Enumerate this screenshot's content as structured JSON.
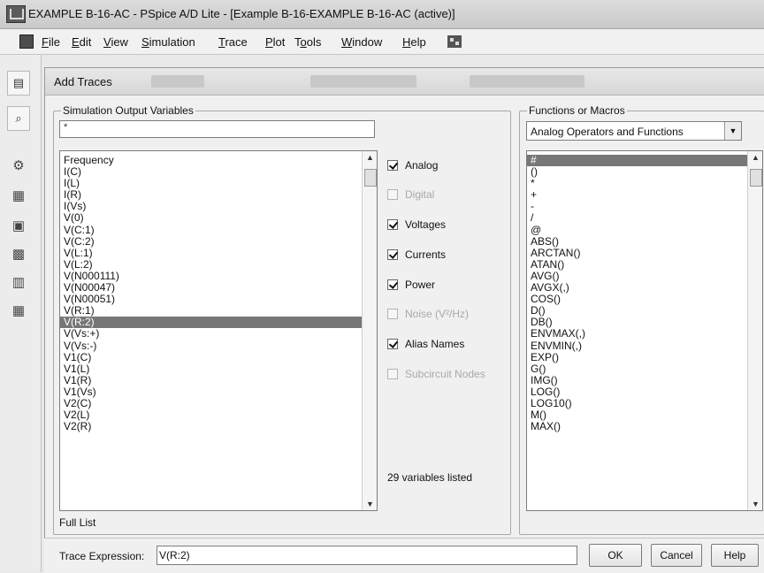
{
  "window": {
    "title": "EXAMPLE B-16-AC - PSpice A/D Lite  - [Example B-16-EXAMPLE B-16-AC (active)]"
  },
  "menu": [
    {
      "pre": "",
      "u": "F",
      "post": "ile"
    },
    {
      "pre": "",
      "u": "E",
      "post": "dit"
    },
    {
      "pre": "",
      "u": "V",
      "post": "iew"
    },
    {
      "pre": "",
      "u": "S",
      "post": "imulation"
    },
    {
      "pre": "",
      "u": "T",
      "post": "race"
    },
    {
      "pre": "",
      "u": "P",
      "post": "lot"
    },
    {
      "pre": "T",
      "u": "o",
      "post": "ols"
    },
    {
      "pre": "",
      "u": "W",
      "post": "indow"
    },
    {
      "pre": "",
      "u": "H",
      "post": "elp"
    }
  ],
  "dialog": {
    "title": "Add Traces",
    "output_group_label": "Simulation Output Variables",
    "filter_value": "*",
    "variables": [
      "Frequency",
      "I(C)",
      "I(L)",
      "I(R)",
      "I(Vs)",
      "V(0)",
      "V(C:1)",
      "V(C:2)",
      "V(L:1)",
      "V(L:2)",
      "V(N000111)",
      "V(N00047)",
      "V(N00051)",
      "V(R:1)",
      "V(R:2)",
      "V(Vs:+)",
      "V(Vs:-)",
      "V1(C)",
      "V1(L)",
      "V1(R)",
      "V1(Vs)",
      "V2(C)",
      "V2(L)",
      "V2(R)"
    ],
    "selected_variable": "V(R:2)",
    "options": [
      {
        "label": "Analog",
        "checked": true,
        "enabled": true
      },
      {
        "label": "Digital",
        "checked": false,
        "enabled": false
      },
      {
        "label": "Voltages",
        "checked": true,
        "enabled": true
      },
      {
        "label": "Currents",
        "checked": true,
        "enabled": true
      },
      {
        "label": "Power",
        "checked": true,
        "enabled": true
      },
      {
        "label": "Noise (V²/Hz)",
        "checked": false,
        "enabled": false
      },
      {
        "label": "Alias Names",
        "checked": true,
        "enabled": true
      },
      {
        "label": "Subcircuit Nodes",
        "checked": false,
        "enabled": false
      }
    ],
    "variable_count": "29 variables listed",
    "list_mode": "Full List",
    "functions_group_label": "Functions or Macros",
    "functions_selected": "Analog Operators and Functions",
    "functions": [
      "#",
      "()",
      "*",
      "+",
      "-",
      "/",
      "@",
      "ABS()",
      "ARCTAN()",
      "ATAN()",
      "AVG()",
      "AVGX(,)",
      "COS()",
      "D()",
      "DB()",
      "ENVMAX(,)",
      "ENVMIN(,)",
      "EXP()",
      "G()",
      "IMG()",
      "LOG()",
      "LOG10()",
      "M()",
      "MAX()"
    ],
    "selected_function": "#",
    "trace_expression_label": "Trace Expression:",
    "trace_expression_value": "V(R:2)",
    "ok_label": "OK",
    "cancel_label": "Cancel",
    "help_label": "Help"
  }
}
